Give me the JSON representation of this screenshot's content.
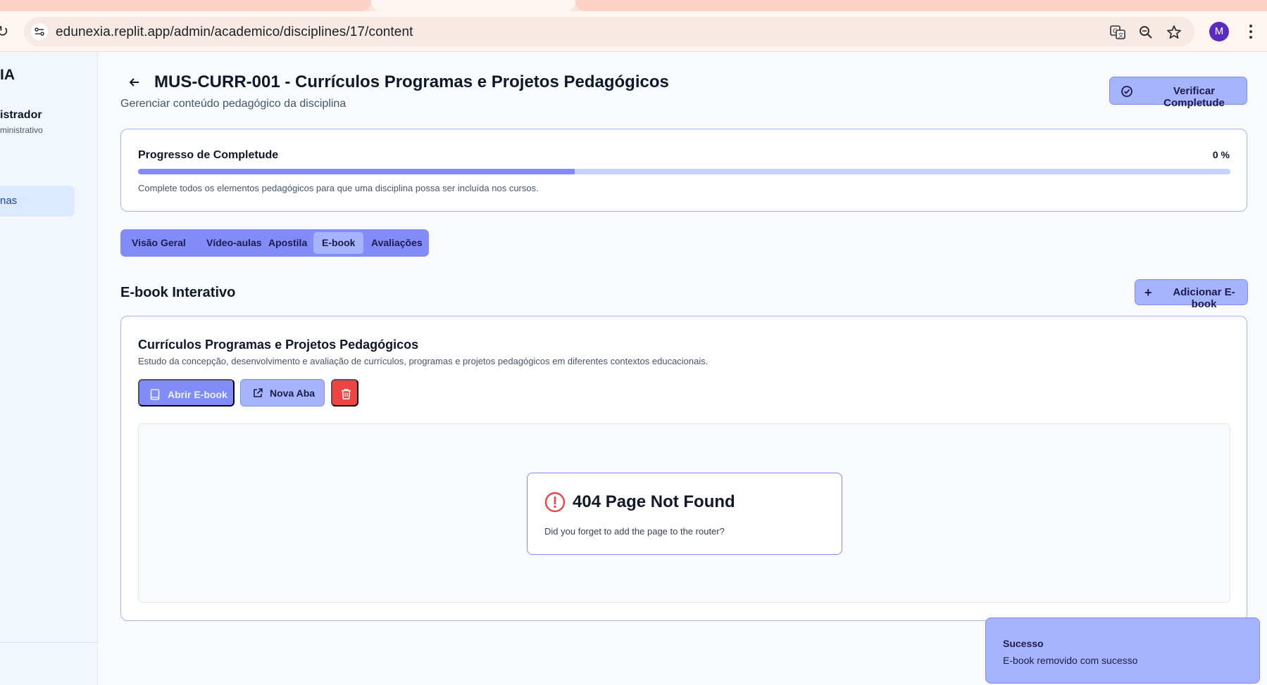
{
  "browser": {
    "url": "edunexia.replit.app/admin/academico/disciplines/17/content",
    "profile_initial": "M"
  },
  "sidebar": {
    "brand": "IA",
    "user_role": "istrador",
    "user_sub": "ministrativo",
    "active_item": "nas"
  },
  "header": {
    "title": "MUS-CURR-001 - Currículos Programas e Projetos Pedagógicos",
    "subtitle": "Gerenciar conteúdo pedagógico da disciplina",
    "verify_button": "Verificar Completude"
  },
  "progress": {
    "label": "Progresso de Completude",
    "percent_text": "0 %",
    "bar_fill_fraction": 0.4,
    "help": "Complete todos os elementos pedagógicos para que uma disciplina possa ser incluída nos cursos."
  },
  "tabs": [
    {
      "label": "Visão Geral",
      "active": false
    },
    {
      "label": "Vídeo-aulas",
      "active": false
    },
    {
      "label": "Apostila",
      "active": false
    },
    {
      "label": "E-book",
      "active": true
    },
    {
      "label": "Avaliações",
      "active": false
    }
  ],
  "ebook_section": {
    "title": "E-book Interativo",
    "add_button": "Adicionar E-book",
    "item": {
      "title": "Currículos Programas e Projetos Pedagógicos",
      "description": "Estudo da concepção, desenvolvimento e avaliação de currículos, programas e projetos pedagógicos em diferentes contextos educacionais.",
      "open_button": "Abrir E-book",
      "new_tab_button": "Nova Aba"
    },
    "embed_error": {
      "title": "404 Page Not Found",
      "message": "Did you forget to add the page to the router?"
    }
  },
  "toast": {
    "title": "Sucesso",
    "message": "E-book removido com sucesso"
  },
  "colors": {
    "accent": "#818cf8",
    "accent_light": "#a5b4fc",
    "danger": "#ef4444"
  }
}
